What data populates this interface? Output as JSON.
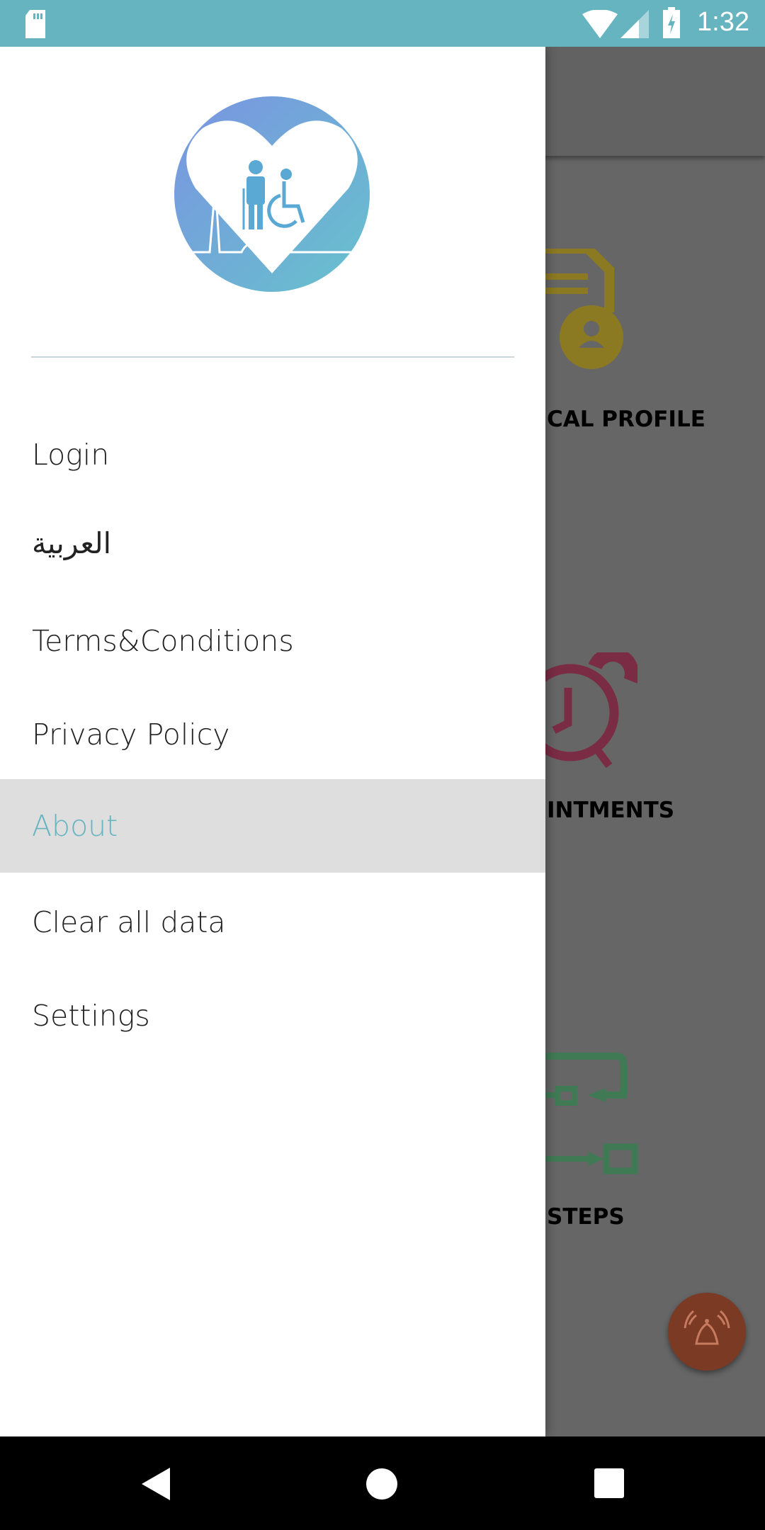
{
  "status_bar": {
    "time": "1:32",
    "icons": [
      "sd-card-icon",
      "wifi-icon",
      "signal-icon",
      "battery-charging-icon"
    ]
  },
  "background": {
    "labels": [
      "CAL PROFILE",
      "INTMENTS",
      "STEPS"
    ],
    "colors": {
      "profile": "#8c7a22",
      "appointments": "#7a2c45",
      "steps": "#3f7a55",
      "fab": "#7a3a24"
    }
  },
  "drawer": {
    "items": [
      {
        "label": "Login"
      },
      {
        "label": "العربية"
      },
      {
        "label": "Terms&Conditions"
      },
      {
        "label": "Privacy Policy"
      },
      {
        "label": "About",
        "active": true
      },
      {
        "label": "Clear all data"
      },
      {
        "label": "Settings"
      }
    ],
    "accent": "#67b4c1"
  }
}
